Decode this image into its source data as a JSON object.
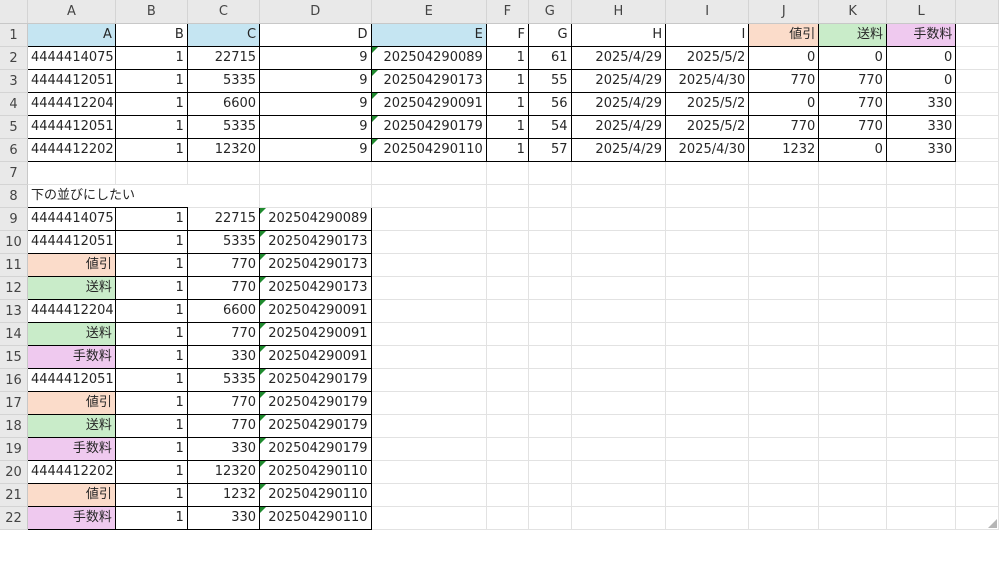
{
  "columns": [
    "A",
    "B",
    "C",
    "D",
    "E",
    "F",
    "G",
    "H",
    "I",
    "J",
    "K",
    "L"
  ],
  "row_numbers": [
    "1",
    "2",
    "3",
    "4",
    "5",
    "6",
    "7",
    "8",
    "9",
    "10",
    "11",
    "12",
    "13",
    "14",
    "15",
    "16",
    "17",
    "18",
    "19",
    "20",
    "21",
    "22"
  ],
  "header_row": [
    "A",
    "B",
    "C",
    "D",
    "E",
    "F",
    "G",
    "H",
    "I",
    "値引",
    "送料",
    "手数料"
  ],
  "rows": [
    [
      "4444414075",
      "1",
      "22715",
      "9",
      "202504290089",
      "1",
      "61",
      "2025/4/29",
      "2025/5/2",
      "0",
      "0",
      "0"
    ],
    [
      "4444412051",
      "1",
      "5335",
      "9",
      "202504290173",
      "1",
      "55",
      "2025/4/29",
      "2025/4/30",
      "770",
      "770",
      "0"
    ],
    [
      "4444412204",
      "1",
      "6600",
      "9",
      "202504290091",
      "1",
      "56",
      "2025/4/29",
      "2025/5/2",
      "0",
      "770",
      "330"
    ],
    [
      "4444412051",
      "1",
      "5335",
      "9",
      "202504290179",
      "1",
      "54",
      "2025/4/29",
      "2025/5/2",
      "770",
      "770",
      "330"
    ],
    [
      "4444412202",
      "1",
      "12320",
      "9",
      "202504290110",
      "1",
      "57",
      "2025/4/29",
      "2025/4/30",
      "1232",
      "0",
      "330"
    ]
  ],
  "note": "下の並びにしたい",
  "result_rows": [
    {
      "a": "4444414075",
      "b": "1",
      "c": "22715",
      "d": "202504290089",
      "kind": ""
    },
    {
      "a": "4444412051",
      "b": "1",
      "c": "5335",
      "d": "202504290173",
      "kind": ""
    },
    {
      "a": "値引",
      "b": "1",
      "c": "770",
      "d": "202504290173",
      "kind": "discount"
    },
    {
      "a": "送料",
      "b": "1",
      "c": "770",
      "d": "202504290173",
      "kind": "shipping"
    },
    {
      "a": "4444412204",
      "b": "1",
      "c": "6600",
      "d": "202504290091",
      "kind": ""
    },
    {
      "a": "送料",
      "b": "1",
      "c": "770",
      "d": "202504290091",
      "kind": "shipping"
    },
    {
      "a": "手数料",
      "b": "1",
      "c": "330",
      "d": "202504290091",
      "kind": "fee"
    },
    {
      "a": "4444412051",
      "b": "1",
      "c": "5335",
      "d": "202504290179",
      "kind": ""
    },
    {
      "a": "値引",
      "b": "1",
      "c": "770",
      "d": "202504290179",
      "kind": "discount"
    },
    {
      "a": "送料",
      "b": "1",
      "c": "770",
      "d": "202504290179",
      "kind": "shipping"
    },
    {
      "a": "手数料",
      "b": "1",
      "c": "330",
      "d": "202504290179",
      "kind": "fee"
    },
    {
      "a": "4444412202",
      "b": "1",
      "c": "12320",
      "d": "202504290110",
      "kind": ""
    },
    {
      "a": "値引",
      "b": "1",
      "c": "1232",
      "d": "202504290110",
      "kind": "discount"
    },
    {
      "a": "手数料",
      "b": "1",
      "c": "330",
      "d": "202504290110",
      "kind": "fee"
    }
  ],
  "colors": {
    "header_blue": "#c5e5f2",
    "discount_peach": "#fbdcca",
    "shipping_green": "#c9ecc9",
    "fee_pink": "#efc9ef",
    "text_marker_green": "#1f8a2e"
  }
}
